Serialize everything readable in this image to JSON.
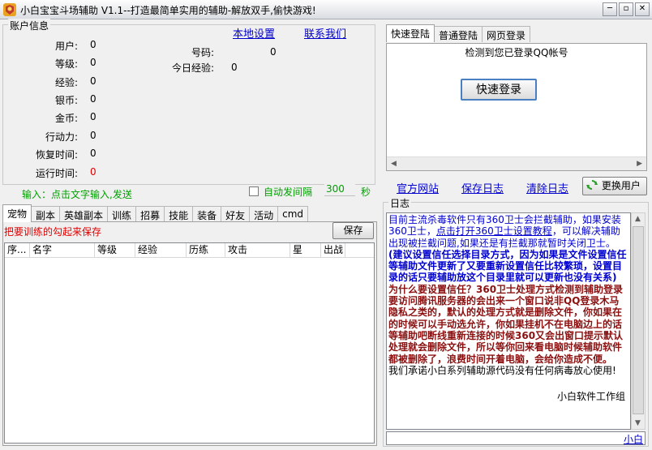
{
  "window": {
    "title": "小白宝宝斗场辅助 V1.1--打造最简单实用的辅助-解放双手,偷快游戏!",
    "minimize": "─",
    "restore": "▫",
    "close": "✕"
  },
  "account": {
    "group_title": "账户信息",
    "local_settings": "本地设置",
    "contact_us": "联系我们",
    "fields": [
      {
        "label": "用户:",
        "value": "0"
      },
      {
        "label": "等级:",
        "value": "0"
      },
      {
        "label": "经验:",
        "value": "0"
      },
      {
        "label": "银币:",
        "value": "0"
      },
      {
        "label": "金币:",
        "value": "0"
      },
      {
        "label": "行动力:",
        "value": "0"
      },
      {
        "label": "恢复时间:",
        "value": "0"
      },
      {
        "label": "运行时间:",
        "value": "0"
      }
    ],
    "id_label": "号码:",
    "id_value": "0",
    "today_exp_label": "今日经验:",
    "today_exp_value": "0",
    "input_hint": "输入：点击文字输入,发送",
    "auto_send_label": "自动发间隔",
    "interval_value": "300",
    "interval_unit": "秒"
  },
  "login": {
    "tabs": [
      "快速登陆",
      "普通登陆",
      "网页登录"
    ],
    "detected_text": "检测到您已登录QQ帐号",
    "quick_login_button": "快速登录"
  },
  "links": {
    "official_site": "官方网站",
    "save_log": "保存日志",
    "clear_log": "清除日志",
    "change_user": "更换用户"
  },
  "pets": {
    "tabs": [
      "宠物",
      "副本",
      "英雄副本",
      "训练",
      "招募",
      "技能",
      "装备",
      "好友",
      "活动",
      "cmd"
    ],
    "hint": "把要训练的勾起来保存",
    "save_button": "保存",
    "columns": [
      "序...",
      "名字",
      "等级",
      "经验",
      "历练",
      "攻击",
      "星",
      "出战"
    ]
  },
  "log": {
    "group_title": "日志",
    "p1": "目前主流杀毒软件只有360卫士会拦截辅助，如果安装360卫士，",
    "p1_link": "点击打开360卫士设置教程",
    "p1_rest": "，可以解决辅助出现被拦截问题,如果还是有拦截那就暂时关闭卫士。",
    "p2": "(建议设置信任选择目录方式，因为如果是文件设置信任等辅助文件更新了又要重新设置信任比较繁琐，设置目录的话只要辅助放这个目录里就可以更新也没有关系)",
    "p3": "为什么要设置信任？360卫士处理方式检测到辅助登录要访问腾讯服务器的会出来一个窗口说非QQ登录木马隐私之类的，默认的处理方式就是删除文件，你如果在的时候可以手动选允许，你如果挂机不在电脑边上的话等辅助吧断线重新连接的时候360又会出窗口提示默认处理就会删除文件，所以等你回来看电脑时候辅助软件都被删除了，浪费时间开着电脑，会给你造成不便。",
    "p4": "我们承诺小白系列辅助源代码没有任何病毒放心使用!",
    "signature": "小白软件工作组",
    "bottom_link": "小白"
  }
}
